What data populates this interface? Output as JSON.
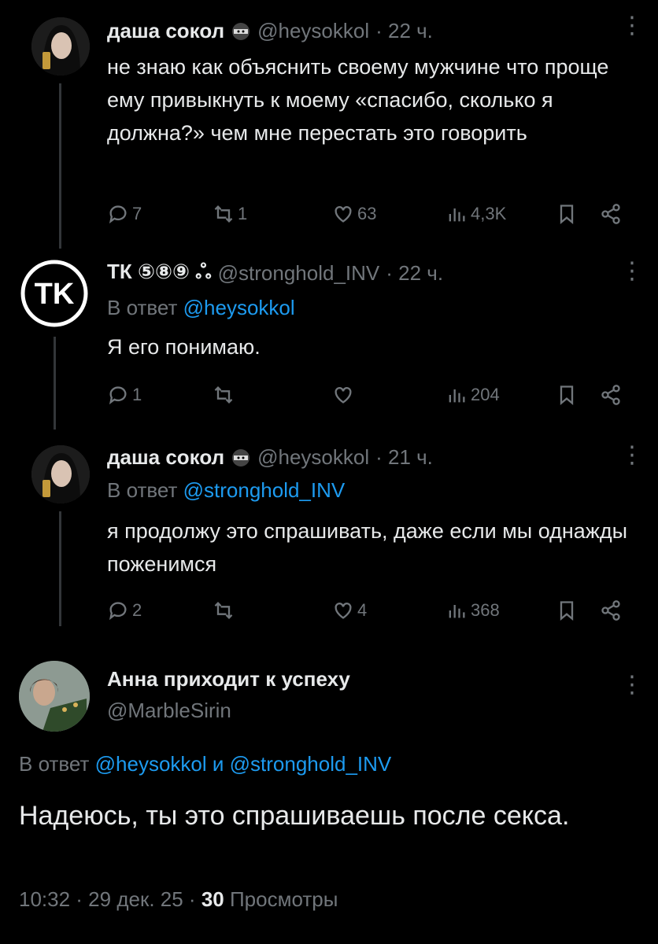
{
  "tweets": [
    {
      "name": "даша сокол",
      "handle": "@heysokkol",
      "time": "· 22 ч.",
      "text": "не знаю как объяснить своему мужчине что проще ему привыкнуть к моему «спасибо, сколько я должна?» чем мне перестать это говорить",
      "replies": "7",
      "reposts": "1",
      "likes": "63",
      "views": "4,3K"
    },
    {
      "name": "ТК ⑤⑧⑨ ஃ",
      "handle": "@stronghold_INV",
      "time": "· 22 ч.",
      "reply_prefix": "В ответ",
      "reply_to": "@heysokkol",
      "text": "Я его понимаю.",
      "replies": "1",
      "reposts": "",
      "likes": "",
      "views": "204",
      "avatar_text": "TK"
    },
    {
      "name": "даша сокол",
      "handle": "@heysokkol",
      "time": "· 21 ч.",
      "reply_prefix": "В ответ",
      "reply_to": "@stronghold_INV",
      "text": "я продолжу это спрашивать, даже если мы однажды поженимся",
      "replies": "2",
      "reposts": "",
      "likes": "4",
      "views": "368"
    }
  ],
  "main": {
    "name": "Анна приходит к успеху",
    "handle": "@MarbleSirin",
    "reply_prefix": "В ответ",
    "reply_to_1": "@heysokkol",
    "reply_and": "и",
    "reply_to_2": "@stronghold_INV",
    "text": "Надеюсь, ты это спрашиваешь после секса.",
    "time": "10:32 · 29 дек. 25 ·",
    "views_count": "30",
    "views_label": "Просмотры"
  },
  "colors": {
    "background": "#000000",
    "text": "#e7e9ea",
    "muted": "#71767b",
    "link": "#1d9bf0"
  }
}
